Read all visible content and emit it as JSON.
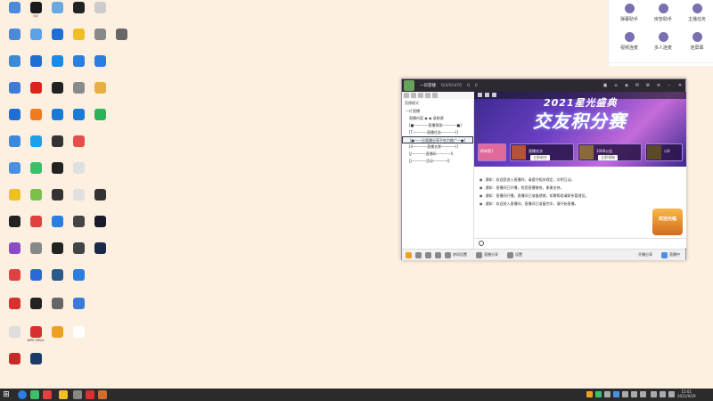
{
  "desktop_icons": [
    {
      "label": "",
      "color": "#4b89dc"
    },
    {
      "label": "QQ",
      "color": "#1a1a1a"
    },
    {
      "label": "",
      "color": "#6aa8e0"
    },
    {
      "label": "",
      "color": "#222"
    },
    {
      "label": "",
      "color": "#ccc"
    },
    {
      "label": "",
      "color": "#4b89dc"
    },
    {
      "label": "",
      "color": "#5ba3e8"
    },
    {
      "label": "",
      "color": "#1d6fd6"
    },
    {
      "label": "",
      "color": "#f0c020"
    },
    {
      "label": "",
      "color": "#888"
    },
    {
      "label": "",
      "color": "#666"
    },
    {
      "label": "",
      "color": "#3b8ad9"
    },
    {
      "label": "",
      "color": "#1d6fd6"
    },
    {
      "label": "",
      "color": "#1a8ae8"
    },
    {
      "label": "",
      "color": "#2a7de1"
    },
    {
      "label": "",
      "color": "#2a7de1"
    },
    {
      "label": "",
      "color": "#3f7bd8"
    },
    {
      "label": "",
      "color": "#d9261c"
    },
    {
      "label": "",
      "color": "#222"
    },
    {
      "label": "",
      "color": "#8a8a8a"
    },
    {
      "label": "",
      "color": "#e8b040"
    },
    {
      "label": "",
      "color": "#1d6fd6"
    },
    {
      "label": "",
      "color": "#f07a20"
    },
    {
      "label": "",
      "color": "#1a7ad8"
    },
    {
      "label": "",
      "color": "#1a7ad8"
    },
    {
      "label": "",
      "color": "#2cb35a"
    },
    {
      "label": "",
      "color": "#3a8ae0"
    },
    {
      "label": "",
      "color": "#1da0e8"
    },
    {
      "label": "",
      "color": "#333"
    },
    {
      "label": "",
      "color": "#e84c4c"
    },
    {
      "label": "",
      "color": "#4a90e2"
    },
    {
      "label": "",
      "color": "#3cbf6a"
    },
    {
      "label": "",
      "color": "#222"
    },
    {
      "label": "",
      "color": "#e0e0e0"
    },
    {
      "label": "",
      "color": "#f0c020"
    },
    {
      "label": "",
      "color": "#7ac04a"
    },
    {
      "label": "",
      "color": "#333"
    },
    {
      "label": "",
      "color": "#e0e0e0"
    },
    {
      "label": "",
      "color": "#333"
    },
    {
      "label": "",
      "color": "#222"
    },
    {
      "label": "",
      "color": "#e04040"
    },
    {
      "label": "",
      "color": "#2a7de1"
    },
    {
      "label": "",
      "color": "#444"
    },
    {
      "label": "",
      "color": "#1a1a2a"
    },
    {
      "label": "",
      "color": "#8a4cc4"
    },
    {
      "label": "",
      "color": "#888"
    },
    {
      "label": "",
      "color": "#222"
    },
    {
      "label": "",
      "color": "#444"
    },
    {
      "label": "",
      "color": "#1a2a4a"
    },
    {
      "label": "",
      "color": "#e04040"
    },
    {
      "label": "",
      "color": "#2a6ad8"
    },
    {
      "label": "",
      "color": "#2a5a8a"
    },
    {
      "label": "",
      "color": "#2a7de1"
    },
    {
      "label": "",
      "color": "#d83030"
    },
    {
      "label": "",
      "color": "#222"
    },
    {
      "label": "",
      "color": "#666"
    },
    {
      "label": "",
      "color": "#3a7ad8"
    },
    {
      "label": "",
      "color": "#ddd"
    },
    {
      "label": "WPS Office",
      "color": "#d83030"
    },
    {
      "label": "",
      "color": "#f0a020"
    },
    {
      "label": "",
      "color": "#fff"
    },
    {
      "label": "",
      "color": "#c82828"
    },
    {
      "label": "",
      "color": "#1a3a6a"
    }
  ],
  "assist_panel": {
    "items": [
      {
        "label": "弹幕助手"
      },
      {
        "label": "房管助手"
      },
      {
        "label": "主播任务"
      },
      {
        "label": "视频连麦"
      },
      {
        "label": "多人连麦"
      },
      {
        "label": "连屏幕"
      }
    ]
  },
  "window": {
    "title": "一日游播",
    "stat1": "0/3/01470",
    "stat2": "0",
    "stat3": "0",
    "left_header": "直播模式",
    "tree": [
      {
        "text": "一片直播"
      },
      {
        "text": "直播内容 ◉ ◉ 录制源"
      },
      {
        "text": "[■————直播预测————■]"
      },
      {
        "text": "[T————直播任务————I]"
      },
      {
        "text": "[●—一分直播分享不吃力推广—●]"
      },
      {
        "text": "[4————直播名称————I]"
      },
      {
        "text": "[J————直播码————I]"
      },
      {
        "text": "[J————活动————I]"
      }
    ],
    "banner": {
      "line1": "2021星光盛典",
      "line2": "交友积分赛",
      "cards": [
        {
          "tx": "榜单第1",
          "bt": "查看"
        },
        {
          "tx": "直播名次",
          "bt": "立即前往"
        },
        {
          "tx": "1000公告",
          "bt": "立即领取"
        },
        {
          "tx": "小0",
          "bt": ""
        }
      ]
    },
    "chat": [
      "通知：欢迎您进入直播间，请遵守相关规定，文明互动。",
      "通知：直播间已开播，祝您直播愉快，谢谢支持。",
      "通知：直播间开播，直播间已准备就绪，如需帮助请联系管理员。",
      "通知：欢迎进入直播间，直播间已准备完毕，请开始直播。"
    ],
    "gift_widget": "欢迎光临",
    "bottom": [
      {
        "label": "美化"
      },
      {
        "label": "音乐"
      },
      {
        "label": "连麦"
      },
      {
        "label": "房间设置"
      },
      {
        "label": "直播分享"
      },
      {
        "label": "设置"
      },
      {
        "label": "开播分享"
      },
      {
        "label": "直播中"
      }
    ]
  },
  "taskbar": {
    "time": "15:01",
    "date": "2021/9/29"
  }
}
